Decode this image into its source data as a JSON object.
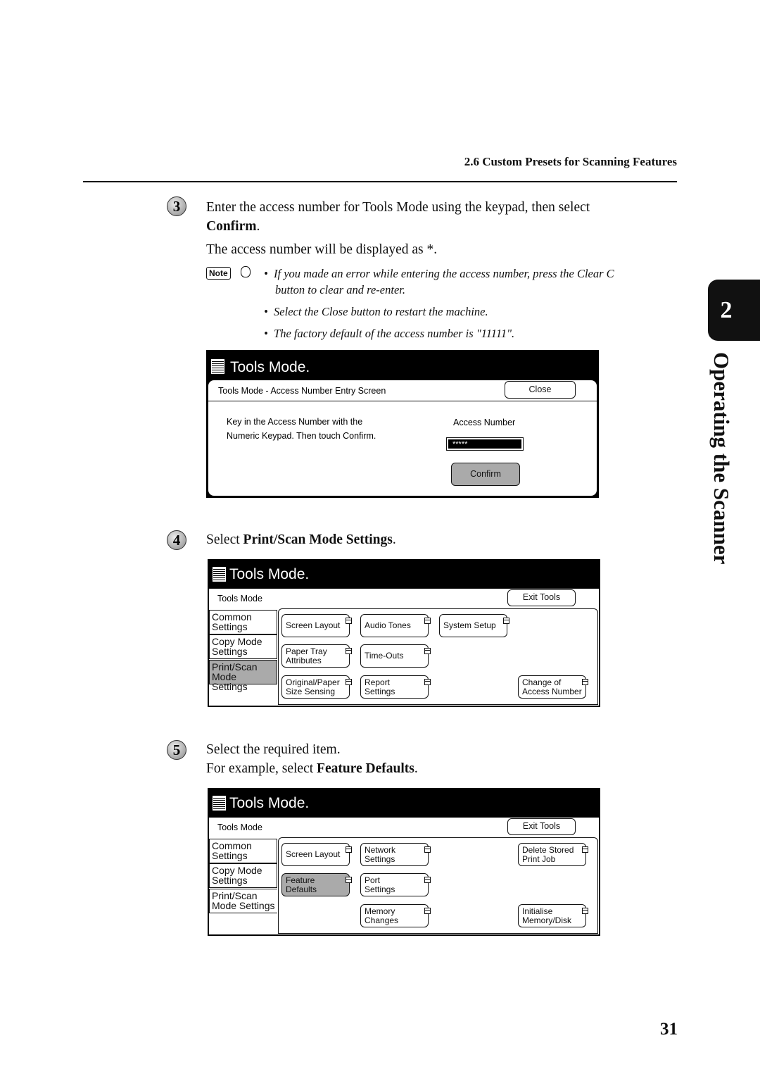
{
  "header": {
    "section": "2.6  Custom Presets for Scanning Features"
  },
  "side_tab": {
    "chapter": "2",
    "title": "Operating the Scanner"
  },
  "page_number": "31",
  "steps": [
    {
      "number": "3",
      "line1": "Enter the access number for Tools Mode using the keypad, then select",
      "line2_bold": "Confirm",
      "line2_end": ".",
      "line3": "The access number will be displayed as *.",
      "note_label": "Note",
      "notes": [
        "If you made an error while entering the access number, press the Clear C",
        "button to clear and re-enter.",
        "Select the Close button to restart the machine.",
        "The factory default of the access number is \"11111\"."
      ]
    },
    {
      "number": "4",
      "prefix": "Select ",
      "bold": "Print/Scan Mode Settings",
      "suffix": "."
    },
    {
      "number": "5",
      "line1": "Select the required item.",
      "prefix": "For example, select ",
      "bold": "Feature Defaults",
      "suffix": "."
    }
  ],
  "screen1": {
    "title": "Tools Mode.",
    "subtitle": "Tools Mode - Access Number Entry Screen",
    "close": "Close",
    "instr1": "Key in the Access Number with the",
    "instr2": "Numeric Keypad.  Then touch Confirm.",
    "field_label": "Access Number",
    "field_value": "*****",
    "confirm": "Confirm"
  },
  "screen2": {
    "title": "Tools Mode.",
    "subtitle": "Tools Mode",
    "exit": "Exit Tools",
    "tabs": [
      [
        "Common",
        "Settings"
      ],
      [
        "Copy Mode",
        "Settings"
      ],
      [
        "Print/Scan",
        "Mode Settings"
      ]
    ],
    "buttons": [
      [
        "Screen Layout"
      ],
      [
        "Audio Tones"
      ],
      [
        "System Setup"
      ],
      [
        "Paper Tray",
        "Attributes"
      ],
      [
        "Time-Outs"
      ],
      [
        "Original/Paper",
        "Size Sensing"
      ],
      [
        "Report",
        "Settings"
      ],
      [
        "Change of",
        "Access Number"
      ]
    ]
  },
  "screen3": {
    "title": "Tools Mode.",
    "subtitle": "Tools Mode",
    "exit": "Exit Tools",
    "tabs": [
      [
        "Common",
        "Settings"
      ],
      [
        "Copy Mode",
        "Settings"
      ],
      [
        "Print/Scan",
        "Mode Settings"
      ]
    ],
    "buttons": [
      [
        "Screen Layout"
      ],
      [
        "Network",
        "Settings"
      ],
      [
        "Delete Stored",
        "Print Job"
      ],
      [
        "Feature",
        "Defaults"
      ],
      [
        "Port",
        "Settings"
      ],
      [
        "Memory",
        "Changes"
      ],
      [
        "Initialise",
        "Memory/Disk"
      ]
    ]
  }
}
